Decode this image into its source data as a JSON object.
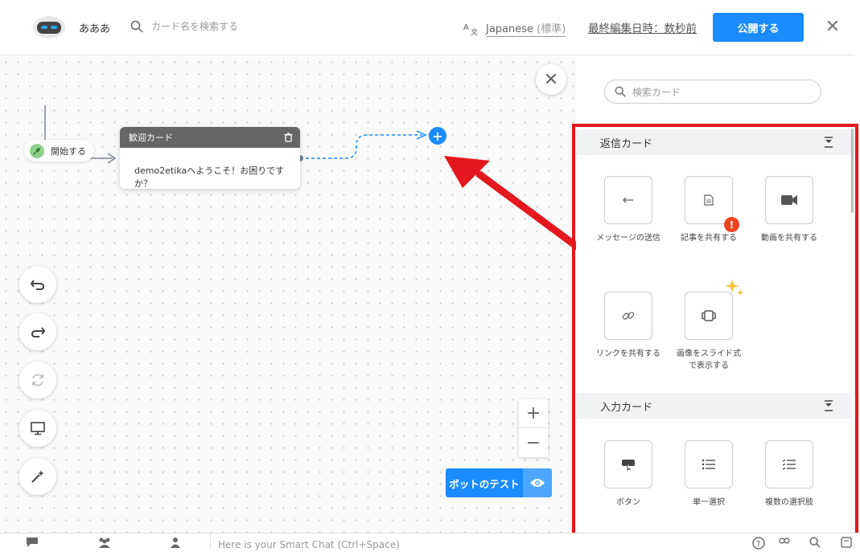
{
  "header": {
    "bot_name": "あああ",
    "search_placeholder": "カード名を検索する",
    "language": "Japanese",
    "language_tag": "(標準)",
    "last_edited": "最終編集日時：数秒前",
    "publish_label": "公開する"
  },
  "canvas": {
    "start_label": "開始する",
    "card_title": "歓迎カード",
    "card_message": "demo2etikaへようこそ！お困りですか？",
    "test_button_label": "ボットのテスト",
    "zoom_in": "+",
    "zoom_out": "−"
  },
  "panel": {
    "search_placeholder": "検索カード",
    "sections": [
      {
        "title": "返信カード",
        "items": [
          {
            "label": "メッセージの送信",
            "icon": "reply-icon"
          },
          {
            "label": "記事を共有する",
            "icon": "document-icon"
          },
          {
            "label": "動画を共有する",
            "icon": "video-icon"
          },
          {
            "label": "リンクを共有する",
            "icon": "link-icon"
          },
          {
            "label": "画像をスライド式で表示する",
            "icon": "carousel-icon"
          }
        ]
      },
      {
        "title": "入力カード",
        "items": [
          {
            "label": "ボタン",
            "icon": "button-icon"
          },
          {
            "label": "単一選択",
            "icon": "list-icon"
          },
          {
            "label": "複数の選択肢",
            "icon": "checklist-icon"
          }
        ]
      }
    ]
  },
  "bottom_bar": {
    "chat_placeholder": "Here is your Smart Chat (Ctrl+Space)"
  },
  "colors": {
    "accent": "#1a8cff",
    "annotation_red": "#e4181e",
    "badge": "#ee4422",
    "card_header": "#666666"
  }
}
